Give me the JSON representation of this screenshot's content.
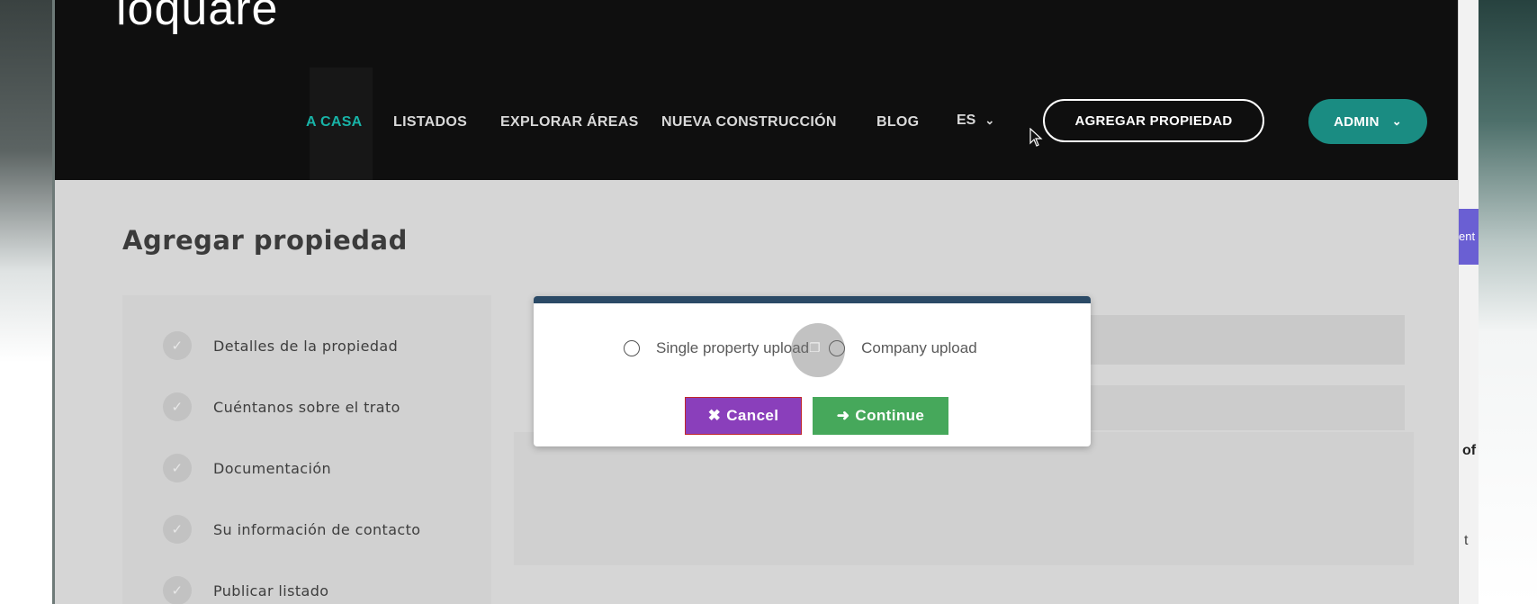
{
  "brand": {
    "logo_text": "loquare"
  },
  "nav": {
    "items": [
      {
        "label": "A CASA",
        "active": true
      },
      {
        "label": "LISTADOS"
      },
      {
        "label": "EXPLORAR ÁREAS"
      },
      {
        "label": "NUEVA CONSTRUCCIÓN"
      },
      {
        "label": "BLOG"
      }
    ],
    "language": "ES",
    "add_property_button": "AGREGAR PROPIEDAD",
    "admin_button": "ADMIN",
    "accent_color": "#18b3a7"
  },
  "page": {
    "title": "Agregar propiedad",
    "steps": [
      "Detalles de la propiedad",
      "Cuéntanos sobre el trato",
      "Documentación",
      "Su información de contacto",
      "Publicar listado"
    ]
  },
  "modal": {
    "options": [
      {
        "label": "Single property upload",
        "selected": false
      },
      {
        "label": "Company upload",
        "selected": false
      }
    ],
    "cancel_label": "Cancel",
    "continue_label": "Continue",
    "cancel_color": "#8a3fbb",
    "continue_color": "#46a85b",
    "header_color": "#2b4a66"
  },
  "side_window": {
    "text1": "ent",
    "text2": "of",
    "text3": "t"
  }
}
